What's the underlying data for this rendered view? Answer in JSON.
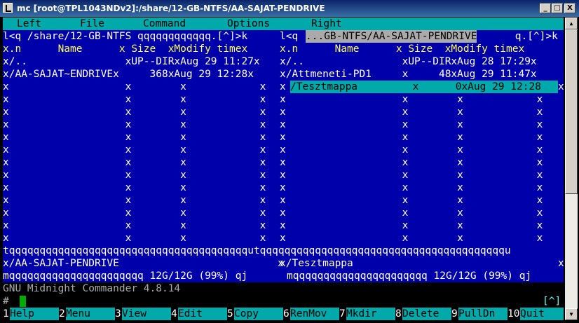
{
  "window": {
    "title": "mc [root@TPL1043NDv2]:/share/12-GB-NTFS/AA-SAJAT-PENDRIVE",
    "min": "_",
    "max": "□",
    "close": "X"
  },
  "menubar": [
    "Left",
    "File",
    "Command",
    "Options",
    "Right"
  ],
  "left_panel": {
    "top_border": "l<q /share/12-GB-NTFS qqqqqqqqqqqq.[^]>k",
    "header": "x.n      Name      x Size  xModify timex",
    "rows": [
      "x/..                xUP--DIRxAug 29 11:27x",
      "x/AA-SAJAT~ENDRIVEx     368xAug 29 12:28x"
    ],
    "path": "x/AA-SAJAT-PENDRIVE",
    "bottom_border": "mqqqqqqqqqqqqqqqqqqqqqq 12G/12G (99%) qj"
  },
  "right_panel": {
    "top_left": "l<q ",
    "top_path": "...GB-NTFS/AA-SAJAT-PENDRIVE",
    "top_right": " q.[^]>k",
    "header": "x.n      Name      x Size  xModify timex",
    "rows": [
      "x/..                xUP--DIRxAug 28 17:29x",
      "x/Attmeneti-PD1     x     48xAug 29 11:47x"
    ],
    "selected": "/Tesztmappa         x      0xAug 29 12:28",
    "path": "x/Tesztmappa",
    "bottom_border": "mqqqqqqqqqqqqqqqqqqqqqq 12G/12G (99%) qj"
  },
  "divider": "tqqqqqqqqqqqqqqqqqqqqqqqqqqqqqqqqqqqqqqqutqqqqqqqqqqqqqqqqqqqqqqqqqqqqqqqqqqqqqqqqu",
  "empty_left": "x                   x        x            x",
  "empty_right": "x                   x        x            x",
  "hint": "GNU Midnight Commander 4.8.14",
  "prompt": "#",
  "prompt_indicator": "[^]",
  "fkeys": [
    {
      "num": "1",
      "label": "Help"
    },
    {
      "num": "2",
      "label": "Menu"
    },
    {
      "num": "3",
      "label": "View"
    },
    {
      "num": "4",
      "label": "Edit"
    },
    {
      "num": "5",
      "label": "Copy"
    },
    {
      "num": "6",
      "label": "RenMov"
    },
    {
      "num": "7",
      "label": "Mkdir"
    },
    {
      "num": "8",
      "label": "Delete"
    },
    {
      "num": "9",
      "label": "PullDn"
    },
    {
      "num": "10",
      "label": "Quit"
    }
  ],
  "colors": {
    "panel_bg": "#0000aa",
    "bar": "#00aaaa",
    "highlight": "#ffff55"
  }
}
